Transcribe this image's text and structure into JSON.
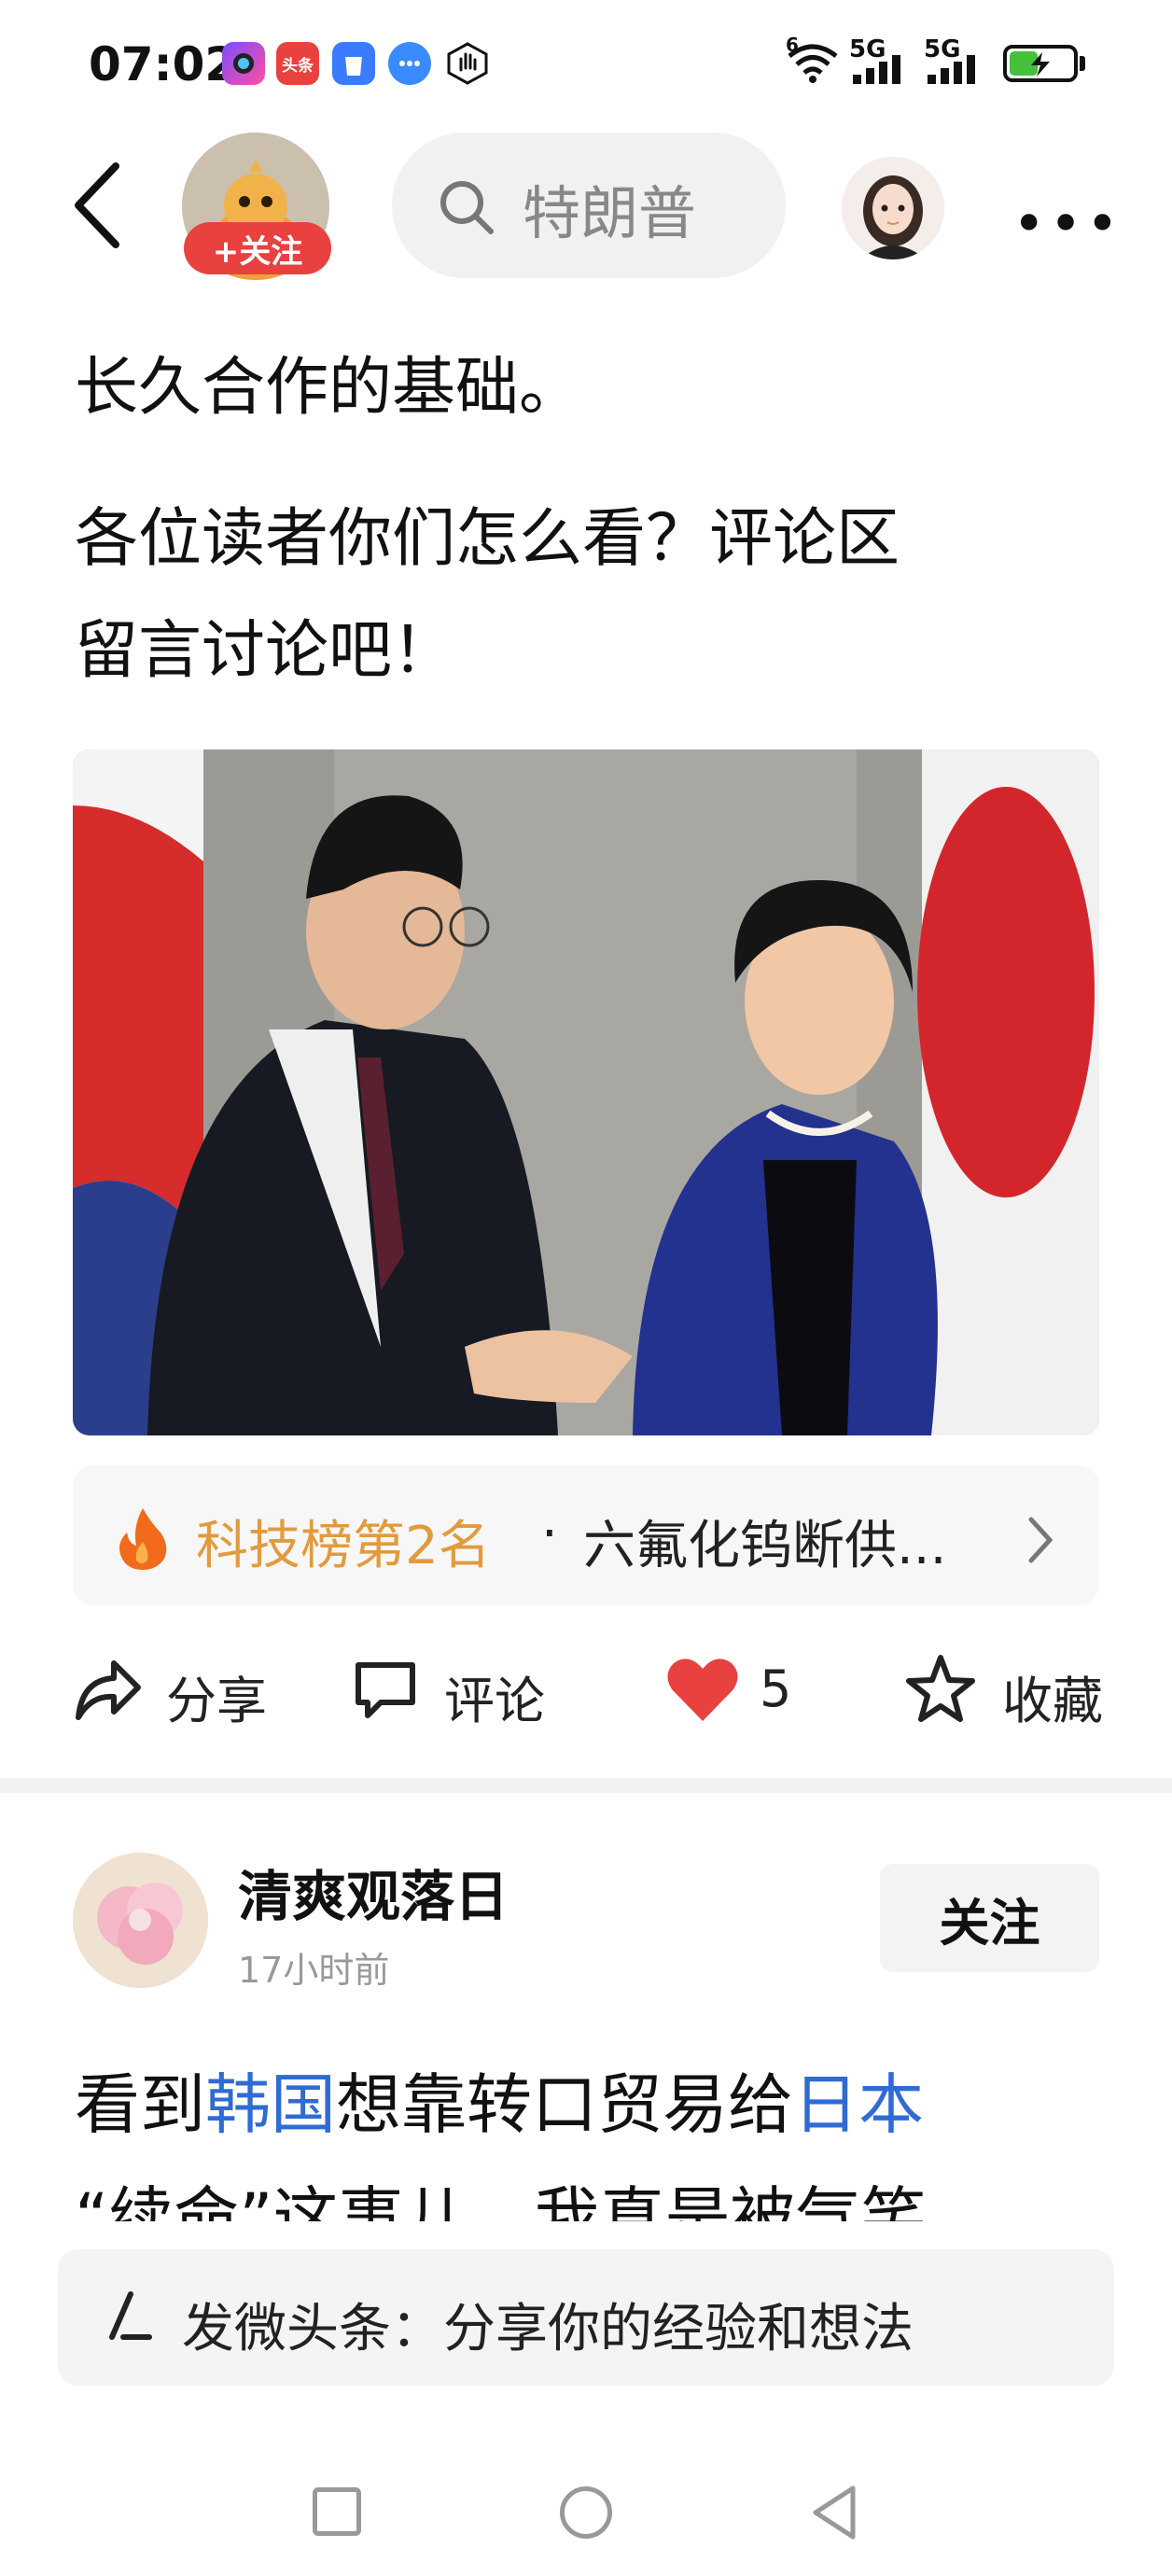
{
  "status_bar": {
    "time": "07:02",
    "app_icons": [
      "camera-app-icon",
      "toutiao-app-icon",
      "app-market-icon",
      "chat-icon",
      "hand-icon"
    ],
    "toutiao_badge": "头条",
    "network_1": "5G",
    "network_2": "5G",
    "wifi_badge": "6",
    "battery_level": 0.45
  },
  "header": {
    "follow_label": "+关注",
    "search_text": "特朗普",
    "more_label": "•••"
  },
  "article": {
    "paragraphs": [
      "长久合作的基础。",
      "各位读者你们怎么看？评论区",
      "留言讨论吧！"
    ]
  },
  "hot_rank": {
    "label": "科技榜第2名",
    "separator": "·",
    "title": "六氟化钨断供..."
  },
  "actions": {
    "share": "分享",
    "comment": "评论",
    "like_count": "5",
    "favorite": "收藏"
  },
  "comment": {
    "user": "清爽观落日",
    "time": "17小时前",
    "follow_label": "关注",
    "text_parts": [
      "看到",
      "韩国",
      "想靠转口贸易给",
      "日本"
    ],
    "text_line2": "“续命”这事儿，我真是被气笑"
  },
  "compose": {
    "placeholder": "发微头条：分享你的经验和想法"
  },
  "colors": {
    "accent_red": "#e8413f",
    "rank_orange": "#e19b3e",
    "link_blue": "#2f6bd3"
  }
}
